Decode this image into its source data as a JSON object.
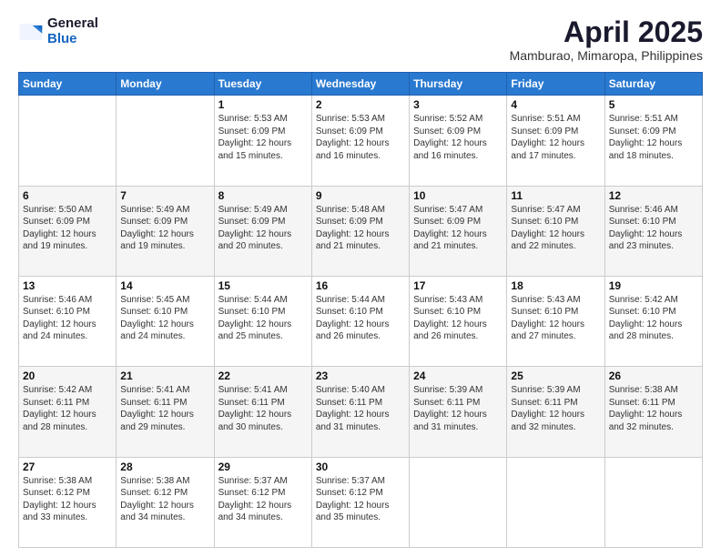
{
  "logo": {
    "general": "General",
    "blue": "Blue"
  },
  "header": {
    "title": "April 2025",
    "subtitle": "Mamburao, Mimaropa, Philippines"
  },
  "weekdays": [
    "Sunday",
    "Monday",
    "Tuesday",
    "Wednesday",
    "Thursday",
    "Friday",
    "Saturday"
  ],
  "weeks": [
    [
      {
        "day": "",
        "info": ""
      },
      {
        "day": "",
        "info": ""
      },
      {
        "day": "1",
        "info": "Sunrise: 5:53 AM\nSunset: 6:09 PM\nDaylight: 12 hours and 15 minutes."
      },
      {
        "day": "2",
        "info": "Sunrise: 5:53 AM\nSunset: 6:09 PM\nDaylight: 12 hours and 16 minutes."
      },
      {
        "day": "3",
        "info": "Sunrise: 5:52 AM\nSunset: 6:09 PM\nDaylight: 12 hours and 16 minutes."
      },
      {
        "day": "4",
        "info": "Sunrise: 5:51 AM\nSunset: 6:09 PM\nDaylight: 12 hours and 17 minutes."
      },
      {
        "day": "5",
        "info": "Sunrise: 5:51 AM\nSunset: 6:09 PM\nDaylight: 12 hours and 18 minutes."
      }
    ],
    [
      {
        "day": "6",
        "info": "Sunrise: 5:50 AM\nSunset: 6:09 PM\nDaylight: 12 hours and 19 minutes."
      },
      {
        "day": "7",
        "info": "Sunrise: 5:49 AM\nSunset: 6:09 PM\nDaylight: 12 hours and 19 minutes."
      },
      {
        "day": "8",
        "info": "Sunrise: 5:49 AM\nSunset: 6:09 PM\nDaylight: 12 hours and 20 minutes."
      },
      {
        "day": "9",
        "info": "Sunrise: 5:48 AM\nSunset: 6:09 PM\nDaylight: 12 hours and 21 minutes."
      },
      {
        "day": "10",
        "info": "Sunrise: 5:47 AM\nSunset: 6:09 PM\nDaylight: 12 hours and 21 minutes."
      },
      {
        "day": "11",
        "info": "Sunrise: 5:47 AM\nSunset: 6:10 PM\nDaylight: 12 hours and 22 minutes."
      },
      {
        "day": "12",
        "info": "Sunrise: 5:46 AM\nSunset: 6:10 PM\nDaylight: 12 hours and 23 minutes."
      }
    ],
    [
      {
        "day": "13",
        "info": "Sunrise: 5:46 AM\nSunset: 6:10 PM\nDaylight: 12 hours and 24 minutes."
      },
      {
        "day": "14",
        "info": "Sunrise: 5:45 AM\nSunset: 6:10 PM\nDaylight: 12 hours and 24 minutes."
      },
      {
        "day": "15",
        "info": "Sunrise: 5:44 AM\nSunset: 6:10 PM\nDaylight: 12 hours and 25 minutes."
      },
      {
        "day": "16",
        "info": "Sunrise: 5:44 AM\nSunset: 6:10 PM\nDaylight: 12 hours and 26 minutes."
      },
      {
        "day": "17",
        "info": "Sunrise: 5:43 AM\nSunset: 6:10 PM\nDaylight: 12 hours and 26 minutes."
      },
      {
        "day": "18",
        "info": "Sunrise: 5:43 AM\nSunset: 6:10 PM\nDaylight: 12 hours and 27 minutes."
      },
      {
        "day": "19",
        "info": "Sunrise: 5:42 AM\nSunset: 6:10 PM\nDaylight: 12 hours and 28 minutes."
      }
    ],
    [
      {
        "day": "20",
        "info": "Sunrise: 5:42 AM\nSunset: 6:11 PM\nDaylight: 12 hours and 28 minutes."
      },
      {
        "day": "21",
        "info": "Sunrise: 5:41 AM\nSunset: 6:11 PM\nDaylight: 12 hours and 29 minutes."
      },
      {
        "day": "22",
        "info": "Sunrise: 5:41 AM\nSunset: 6:11 PM\nDaylight: 12 hours and 30 minutes."
      },
      {
        "day": "23",
        "info": "Sunrise: 5:40 AM\nSunset: 6:11 PM\nDaylight: 12 hours and 31 minutes."
      },
      {
        "day": "24",
        "info": "Sunrise: 5:39 AM\nSunset: 6:11 PM\nDaylight: 12 hours and 31 minutes."
      },
      {
        "day": "25",
        "info": "Sunrise: 5:39 AM\nSunset: 6:11 PM\nDaylight: 12 hours and 32 minutes."
      },
      {
        "day": "26",
        "info": "Sunrise: 5:38 AM\nSunset: 6:11 PM\nDaylight: 12 hours and 32 minutes."
      }
    ],
    [
      {
        "day": "27",
        "info": "Sunrise: 5:38 AM\nSunset: 6:12 PM\nDaylight: 12 hours and 33 minutes."
      },
      {
        "day": "28",
        "info": "Sunrise: 5:38 AM\nSunset: 6:12 PM\nDaylight: 12 hours and 34 minutes."
      },
      {
        "day": "29",
        "info": "Sunrise: 5:37 AM\nSunset: 6:12 PM\nDaylight: 12 hours and 34 minutes."
      },
      {
        "day": "30",
        "info": "Sunrise: 5:37 AM\nSunset: 6:12 PM\nDaylight: 12 hours and 35 minutes."
      },
      {
        "day": "",
        "info": ""
      },
      {
        "day": "",
        "info": ""
      },
      {
        "day": "",
        "info": ""
      }
    ]
  ]
}
